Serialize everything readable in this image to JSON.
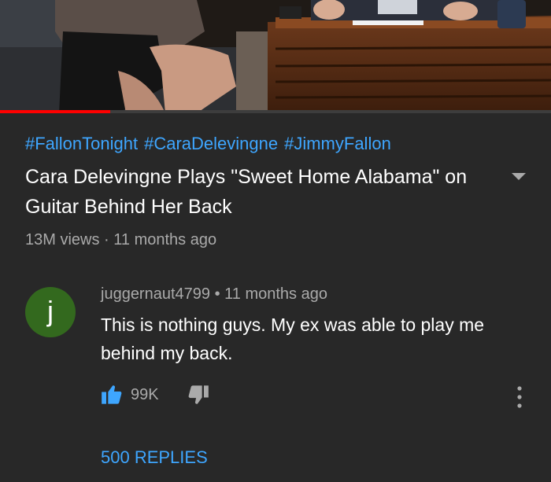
{
  "video": {
    "progress_fraction": 0.2
  },
  "hashtags": [
    "#FallonTonight",
    "#CaraDelevingne",
    "#JimmyFallon"
  ],
  "title": "Cara Delevingne Plays \"Sweet Home Alabama\" on Guitar Behind Her Back",
  "meta": "13M views · 11 months ago",
  "comment": {
    "avatar_letter": "j",
    "avatar_color": "#33691e",
    "header": "juggernaut4799 • 11 months ago",
    "text": "This is  nothing guys. My ex was able to play me behind my back.",
    "like_count": "99K",
    "like_icon": "thumbs-up-icon",
    "dislike_icon": "thumbs-down-icon",
    "more_icon": "vertical-dots-icon",
    "replies_label": "500 REPLIES"
  },
  "colors": {
    "background": "#282828",
    "link": "#3ea6ff",
    "secondary_text": "#aaaaaa",
    "progress": "#ff0000"
  }
}
